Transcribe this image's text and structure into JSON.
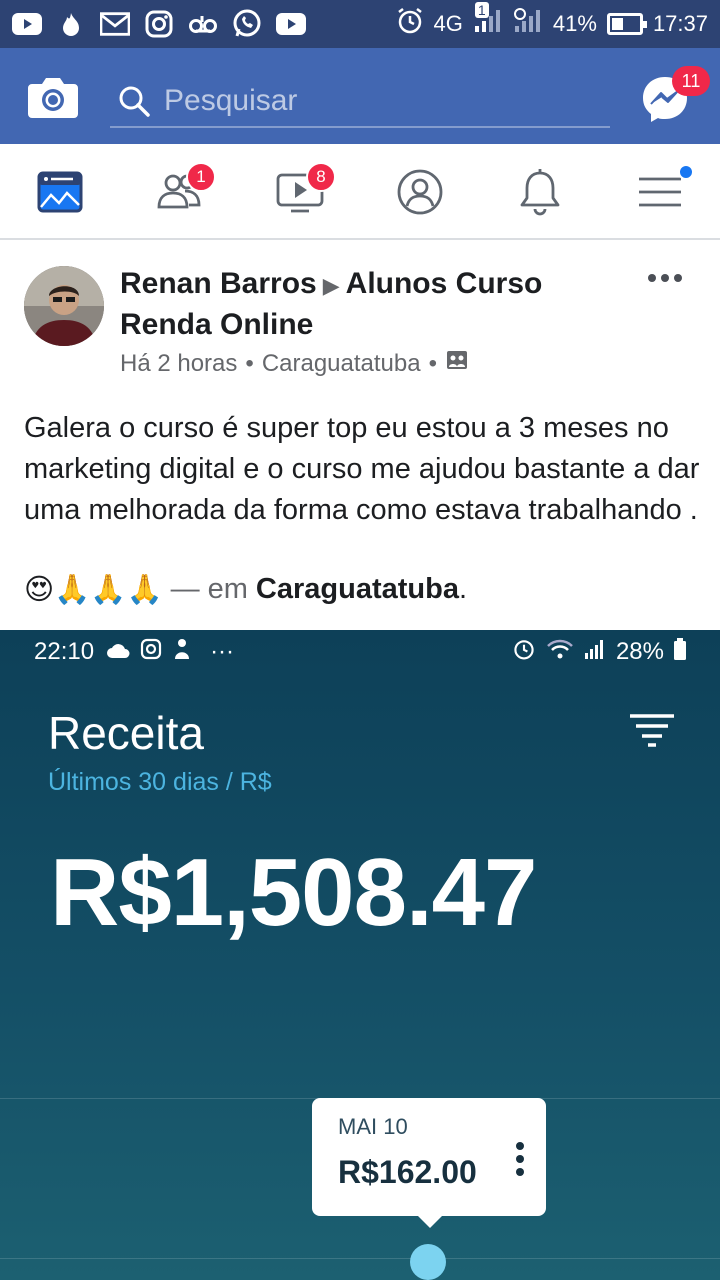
{
  "status_bar": {
    "network": "4G",
    "sim_badge": "1",
    "battery_percent": "41%",
    "battery_level": 0.41,
    "time": "17:37",
    "icons": [
      "youtube-icon",
      "tinder-icon",
      "gmail-icon",
      "instagram-icon",
      "voicemail-icon",
      "whatsapp-icon",
      "youtube-icon",
      "alarm-icon",
      "signal-icon",
      "battery-icon"
    ]
  },
  "app_bar": {
    "search_placeholder": "Pesquisar",
    "messenger_badge": "11"
  },
  "tabs": {
    "friends_badge": "1",
    "watch_badge": "8"
  },
  "post": {
    "author": "Renan Barros",
    "group": "Alunos Curso Renda Online",
    "time": "Há 2 horas",
    "location": "Caraguatatuba",
    "text": "Galera o curso é super top eu estou a 3 meses no marketing digital e o curso me ajudou bastante a dar uma melhorada da forma como estava trabalhando .",
    "emojis": "😍🙏🙏🙏",
    "checkin_prefix": "— em",
    "checkin_place": "Caraguatatuba",
    "checkin_suffix": "."
  },
  "embedded_screenshot": {
    "status_time": "22:10",
    "status_dots": "···",
    "status_battery": "28%",
    "title": "Receita",
    "subtitle": "Últimos 30 dias / R$",
    "amount": "R$1,508.47",
    "tooltip": {
      "date": "MAI 10",
      "value": "R$162.00"
    }
  }
}
